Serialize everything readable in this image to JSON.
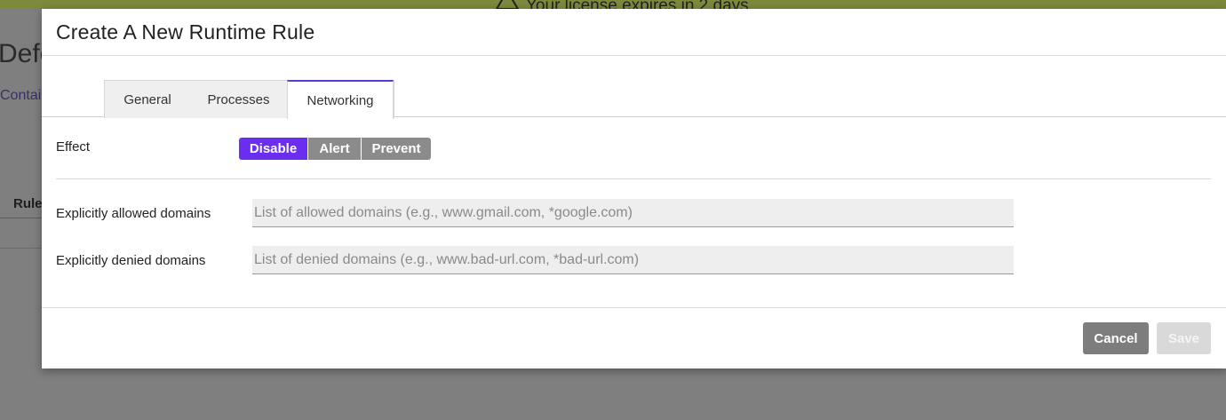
{
  "background": {
    "banner_text": "Your license expires in 2 days",
    "page_title": "Defe",
    "subnav_label": "Contai",
    "column_header": "Rule"
  },
  "modal": {
    "title": "Create A New Runtime Rule",
    "tabs": [
      {
        "label": "General",
        "active": false
      },
      {
        "label": "Processes",
        "active": false
      },
      {
        "label": "Networking",
        "active": true
      }
    ],
    "effect": {
      "label": "Effect",
      "options": [
        {
          "label": "Disable",
          "selected": true
        },
        {
          "label": "Alert",
          "selected": false
        },
        {
          "label": "Prevent",
          "selected": false
        }
      ]
    },
    "allowed_domains": {
      "label": "Explicitly allowed domains",
      "value": "",
      "placeholder": "List of allowed domains (e.g., www.gmail.com, *google.com)"
    },
    "denied_domains": {
      "label": "Explicitly denied domains",
      "value": "",
      "placeholder": "List of denied domains (e.g., www.bad-url.com, *bad-url.com)"
    },
    "buttons": {
      "cancel": "Cancel",
      "save": "Save"
    }
  },
  "colors": {
    "accent": "#6b2ef0",
    "tab_active_border": "#5b3bd1",
    "banner": "#7d8a3c",
    "overlay": "#808080"
  }
}
